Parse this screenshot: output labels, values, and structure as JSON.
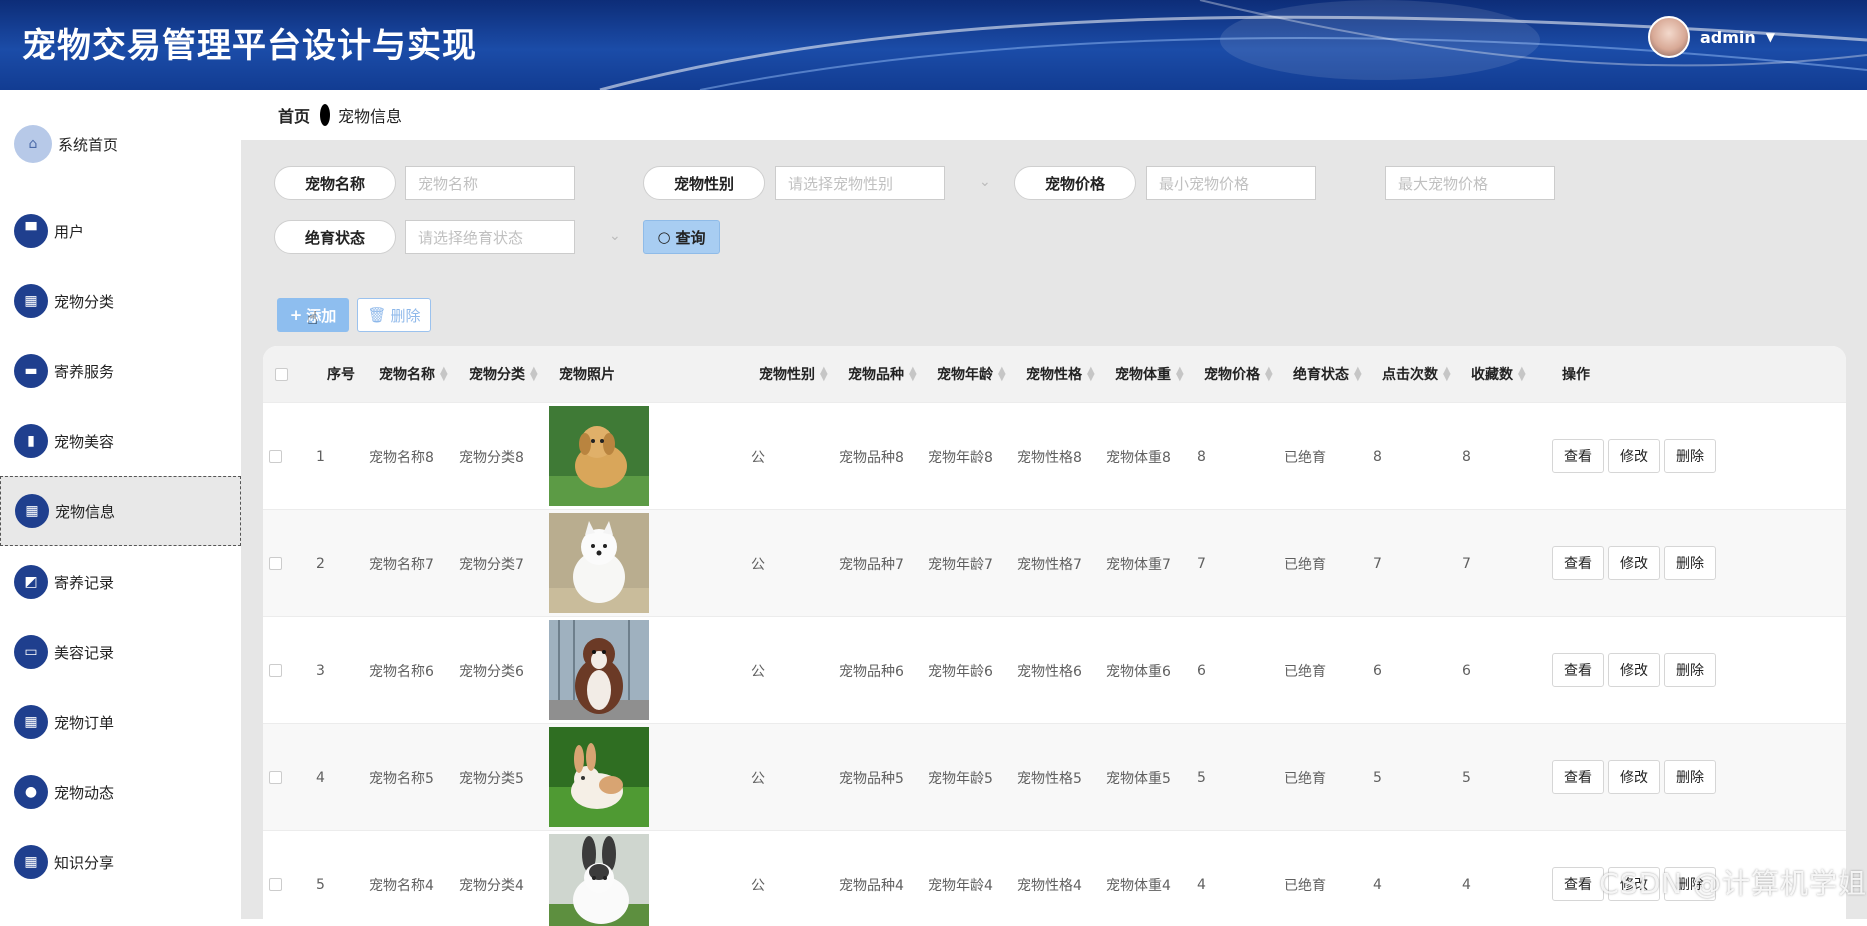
{
  "app": {
    "title": "宠物交易管理平台设计与实现"
  },
  "user": {
    "name": "admin",
    "caret": "▼"
  },
  "sidebar": {
    "items": [
      {
        "label": "系统首页",
        "icon": "home-icon",
        "glyph": "⌂"
      },
      {
        "label": "用户",
        "icon": "brush-icon",
        "glyph": "▀"
      },
      {
        "label": "宠物分类",
        "icon": "grid-icon",
        "glyph": "▦"
      },
      {
        "label": "寄养服务",
        "icon": "ticket-icon",
        "glyph": "▬"
      },
      {
        "label": "宠物美容",
        "icon": "bar-chart-icon",
        "glyph": "▮"
      },
      {
        "label": "宠物信息",
        "icon": "grid-icon",
        "glyph": "▦",
        "active": true
      },
      {
        "label": "寄养记录",
        "icon": "line-chart-icon",
        "glyph": "◩"
      },
      {
        "label": "美容记录",
        "icon": "monitor-icon",
        "glyph": "▭"
      },
      {
        "label": "宠物订单",
        "icon": "grid-icon",
        "glyph": "▦"
      },
      {
        "label": "宠物动态",
        "icon": "user-icon",
        "glyph": "●"
      },
      {
        "label": "知识分享",
        "icon": "grid-icon",
        "glyph": "▦"
      }
    ]
  },
  "breadcrumb": {
    "home": "首页",
    "current": "宠物信息"
  },
  "search": {
    "name_label": "宠物名称",
    "name_placeholder": "宠物名称",
    "gender_label": "宠物性别",
    "gender_placeholder": "请选择宠物性别",
    "price_label": "宠物价格",
    "price_min_placeholder": "最小宠物价格",
    "price_max_placeholder": "最大宠物价格",
    "sterile_label": "绝育状态",
    "sterile_placeholder": "请选择绝育状态",
    "query_label": "查询"
  },
  "toolbar": {
    "add_label": "添加",
    "delete_label": "删除"
  },
  "table": {
    "headers": {
      "index": "序号",
      "name": "宠物名称",
      "category": "宠物分类",
      "photo": "宠物照片",
      "gender": "宠物性别",
      "breed": "宠物品种",
      "age": "宠物年龄",
      "temper": "宠物性格",
      "weight": "宠物体重",
      "price": "宠物价格",
      "sterile": "绝育状态",
      "clicks": "点击次数",
      "favorites": "收藏数",
      "actions": "操作"
    },
    "action_labels": {
      "view": "查看",
      "edit": "修改",
      "delete": "删除"
    },
    "rows": [
      {
        "index": "1",
        "name": "宠物名称8",
        "category": "宠物分类8",
        "photo": "golden-puppy",
        "gender": "公",
        "breed": "宠物品种8",
        "age": "宠物年龄8",
        "temper": "宠物性格8",
        "weight": "宠物体重8",
        "price": "8",
        "sterile": "已绝育",
        "clicks": "8",
        "favorites": "8"
      },
      {
        "index": "2",
        "name": "宠物名称7",
        "category": "宠物分类7",
        "photo": "samoyed",
        "gender": "公",
        "breed": "宠物品种7",
        "age": "宠物年龄7",
        "temper": "宠物性格7",
        "weight": "宠物体重7",
        "price": "7",
        "sterile": "已绝育",
        "clicks": "7",
        "favorites": "7"
      },
      {
        "index": "3",
        "name": "宠物名称6",
        "category": "宠物分类6",
        "photo": "malamute",
        "gender": "公",
        "breed": "宠物品种6",
        "age": "宠物年龄6",
        "temper": "宠物性格6",
        "weight": "宠物体重6",
        "price": "6",
        "sterile": "已绝育",
        "clicks": "6",
        "favorites": "6"
      },
      {
        "index": "4",
        "name": "宠物名称5",
        "category": "宠物分类5",
        "photo": "rabbit-brown",
        "gender": "公",
        "breed": "宠物品种5",
        "age": "宠物年龄5",
        "temper": "宠物性格5",
        "weight": "宠物体重5",
        "price": "5",
        "sterile": "已绝育",
        "clicks": "5",
        "favorites": "5"
      },
      {
        "index": "5",
        "name": "宠物名称4",
        "category": "宠物分类4",
        "photo": "rabbit-white",
        "gender": "公",
        "breed": "宠物品种4",
        "age": "宠物年龄4",
        "temper": "宠物性格4",
        "weight": "宠物体重4",
        "price": "4",
        "sterile": "已绝育",
        "clicks": "4",
        "favorites": "4"
      }
    ]
  },
  "watermark": "CSDN @计算机学姐",
  "colors": {
    "header": "#1b4ca8",
    "menu_icon": "#1f3f8e",
    "primary_btn": "#8ebeef",
    "query_btn": "#a8cdf2"
  }
}
